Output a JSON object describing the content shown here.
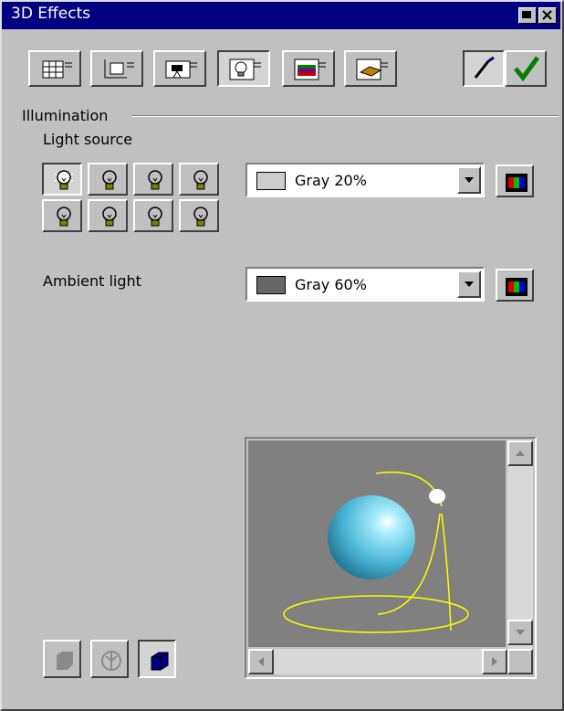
{
  "window": {
    "title": "3D Effects"
  },
  "toolbar": {
    "tools": [
      {
        "name": "geometry",
        "icon": "geometry-icon",
        "pressed": false
      },
      {
        "name": "shading",
        "icon": "shading-icon",
        "pressed": false
      },
      {
        "name": "lighting-camera",
        "icon": "camera-icon",
        "pressed": false
      },
      {
        "name": "illumination",
        "icon": "light-bulb-icon",
        "pressed": true
      },
      {
        "name": "textures",
        "icon": "textures-icon",
        "pressed": false
      },
      {
        "name": "material",
        "icon": "material-icon",
        "pressed": false
      }
    ],
    "assign_icon": "pipette-icon",
    "apply_icon": "checkmark-icon"
  },
  "illumination": {
    "group_label": "Illumination",
    "light_source_label": "Light source",
    "light_source_color": {
      "label": "Gray 20%",
      "swatch": "#cccccc"
    },
    "ambient_label": "Ambient light",
    "ambient_color": {
      "label": "Gray 60%",
      "swatch": "#666666"
    },
    "selected_light_index": 0,
    "light_count": 8
  },
  "colors": {
    "titlebar": "#000080",
    "face": "#c0c0c0",
    "preview_bg": "#808080",
    "light_path": "#ffff00",
    "sphere": "#5ecbea",
    "checkmark": "#008000"
  },
  "preview": {
    "icon": "sphere-preview"
  }
}
